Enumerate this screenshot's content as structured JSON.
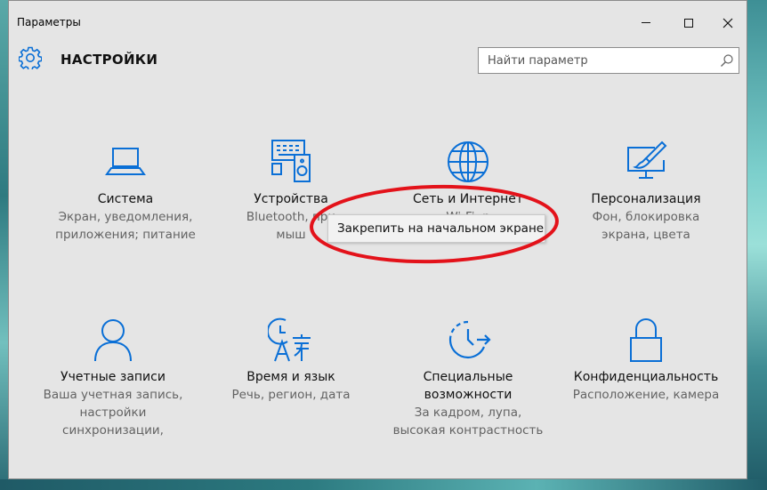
{
  "window": {
    "title": "Параметры"
  },
  "header": {
    "title": "НАСТРОЙКИ",
    "search": {
      "placeholder": "Найти параметр"
    }
  },
  "tiles": [
    {
      "icon": "laptop-icon",
      "title": "Система",
      "subtitle": [
        "Экран, уведомления,",
        "приложения; питание"
      ]
    },
    {
      "icon": "devices-icon",
      "title": "Устройства",
      "subtitle": [
        "Bluetooth, при",
        "мыш"
      ]
    },
    {
      "icon": "globe-icon",
      "title": "Сеть и Интернет",
      "subtitle": [
        "Wi-Fi, р",
        ""
      ]
    },
    {
      "icon": "personalization-icon",
      "title": "Персонализация",
      "subtitle": [
        "Фон, блокировка",
        "экрана, цвета"
      ]
    },
    {
      "icon": "person-icon",
      "title": "Учетные записи",
      "subtitle": [
        "Ваша учетная запись,",
        "настройки",
        "синхронизации,"
      ]
    },
    {
      "icon": "time-language-icon",
      "title": "Время и язык",
      "subtitle": [
        "Речь, регион, дата"
      ]
    },
    {
      "icon": "accessibility-icon",
      "title": "Специальные возможности",
      "title_lines": [
        "Специальные",
        "возможности"
      ],
      "subtitle": [
        "За кадром, лупа,",
        "высокая контрастность"
      ]
    },
    {
      "icon": "lock-icon",
      "title": "Конфиденциальность",
      "subtitle": [
        "Расположение, камера"
      ]
    }
  ],
  "context_menu": {
    "item": "Закрепить на начальном экране"
  },
  "colors": {
    "accent": "#0a6fd6",
    "highlight_ring": "#e3121a",
    "window_bg": "#e5e5e5"
  }
}
